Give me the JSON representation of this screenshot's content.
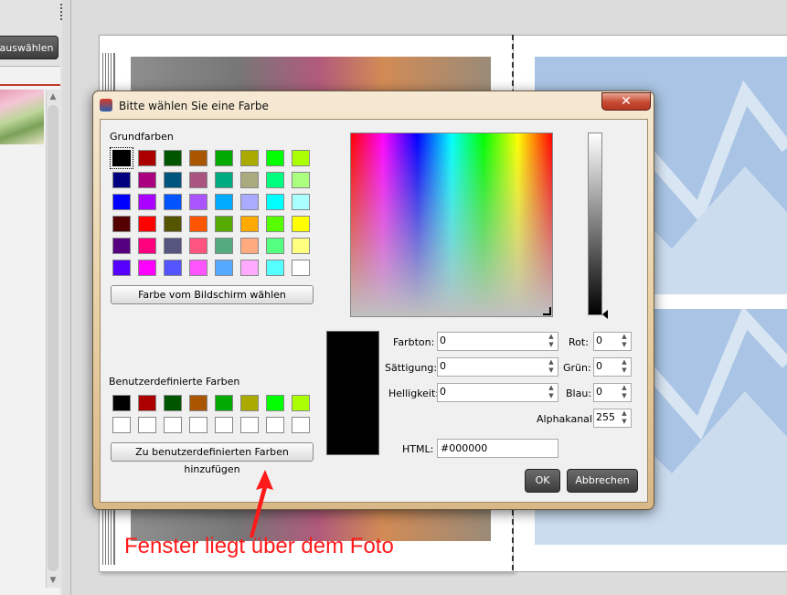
{
  "app": {
    "select_button": "auswählen"
  },
  "dialog": {
    "title": "Bitte wählen Sie eine Farbe",
    "close_glyph": "✕",
    "basic_colors_label": "Grundfarben",
    "basic_colors": [
      [
        "#000000",
        "#aa0000",
        "#005500",
        "#aa5500",
        "#00aa00",
        "#aaaa00",
        "#00ff00",
        "#aaff00"
      ],
      [
        "#00007f",
        "#aa007f",
        "#00557f",
        "#aa557f",
        "#00aa7f",
        "#aaaa7f",
        "#00ff7f",
        "#aaff7f"
      ],
      [
        "#0000ff",
        "#aa00ff",
        "#0055ff",
        "#aa55ff",
        "#00aaff",
        "#aaaaff",
        "#00ffff",
        "#aaffff"
      ],
      [
        "#550000",
        "#ff0000",
        "#555500",
        "#ff5500",
        "#55aa00",
        "#ffaa00",
        "#55ff00",
        "#ffff00"
      ],
      [
        "#55007f",
        "#ff007f",
        "#55557f",
        "#ff557f",
        "#55aa7f",
        "#ffaa7f",
        "#55ff7f",
        "#ffff7f"
      ],
      [
        "#5500ff",
        "#ff00ff",
        "#5555ff",
        "#ff55ff",
        "#55aaff",
        "#ffaaff",
        "#55ffff",
        "#ffffff"
      ]
    ],
    "pick_screen_button": "Farbe vom Bildschirm wählen",
    "custom_colors_label": "Benutzerdefinierte Farben",
    "custom_colors": [
      [
        "#000000",
        "#aa0000",
        "#005500",
        "#aa5500",
        "#00aa00",
        "#aaaa00",
        "#00ff00",
        "#aaff00"
      ],
      [
        "#ffffff",
        "#ffffff",
        "#ffffff",
        "#ffffff",
        "#ffffff",
        "#ffffff",
        "#ffffff",
        "#ffffff"
      ]
    ],
    "add_custom_button": "Zu benutzerdefinierten Farben hinzufügen",
    "preview_color": "#000000",
    "fields": {
      "hue_label": "Farbton:",
      "hue_value": "0",
      "saturation_label": "Sättigung:",
      "saturation_value": "0",
      "value_label": "Helligkeit:",
      "value_value": "0",
      "red_label": "Rot:",
      "red_value": "0",
      "green_label": "Grün:",
      "green_value": "0",
      "blue_label": "Blau:",
      "blue_value": "0",
      "alpha_label": "Alphakanal:",
      "alpha_value": "255",
      "html_label": "HTML:",
      "html_value": "#000000"
    },
    "ok_button": "OK",
    "cancel_button": "Abbrechen"
  },
  "annotation": {
    "text": "Fenster liegt über dem Foto",
    "color": "#ff1a1a"
  }
}
